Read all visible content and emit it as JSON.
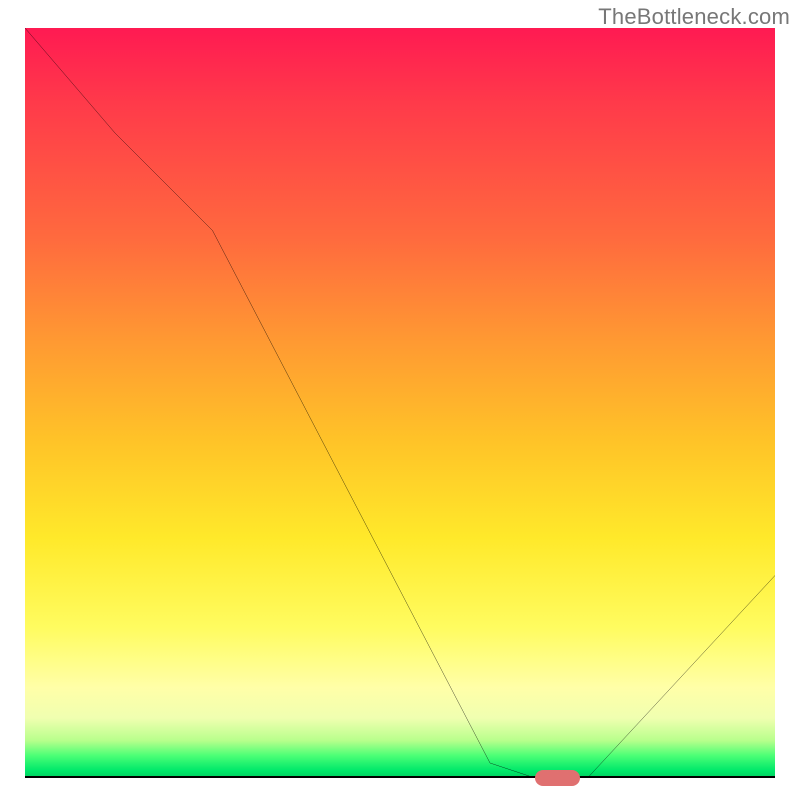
{
  "watermark": "TheBottleneck.com",
  "chart_data": {
    "type": "line",
    "title": "",
    "xlabel": "",
    "ylabel": "",
    "xlim": [
      0,
      100
    ],
    "ylim": [
      0,
      100
    ],
    "grid": false,
    "legend": false,
    "series": [
      {
        "name": "bottleneck-curve",
        "x": [
          0,
          12,
          25,
          62,
          68,
          75,
          100
        ],
        "values": [
          100,
          86,
          73,
          2,
          0,
          0,
          27
        ]
      }
    ],
    "marker": {
      "name": "optimal-range",
      "x_center": 71,
      "y": 0,
      "width_pct": 6,
      "color": "#e07070"
    },
    "background_gradient": {
      "top": "#ff1a52",
      "upper_mid": "#ff9a32",
      "mid": "#ffe92a",
      "lower_mid": "#ffffa8",
      "bottom": "#00d060"
    }
  }
}
